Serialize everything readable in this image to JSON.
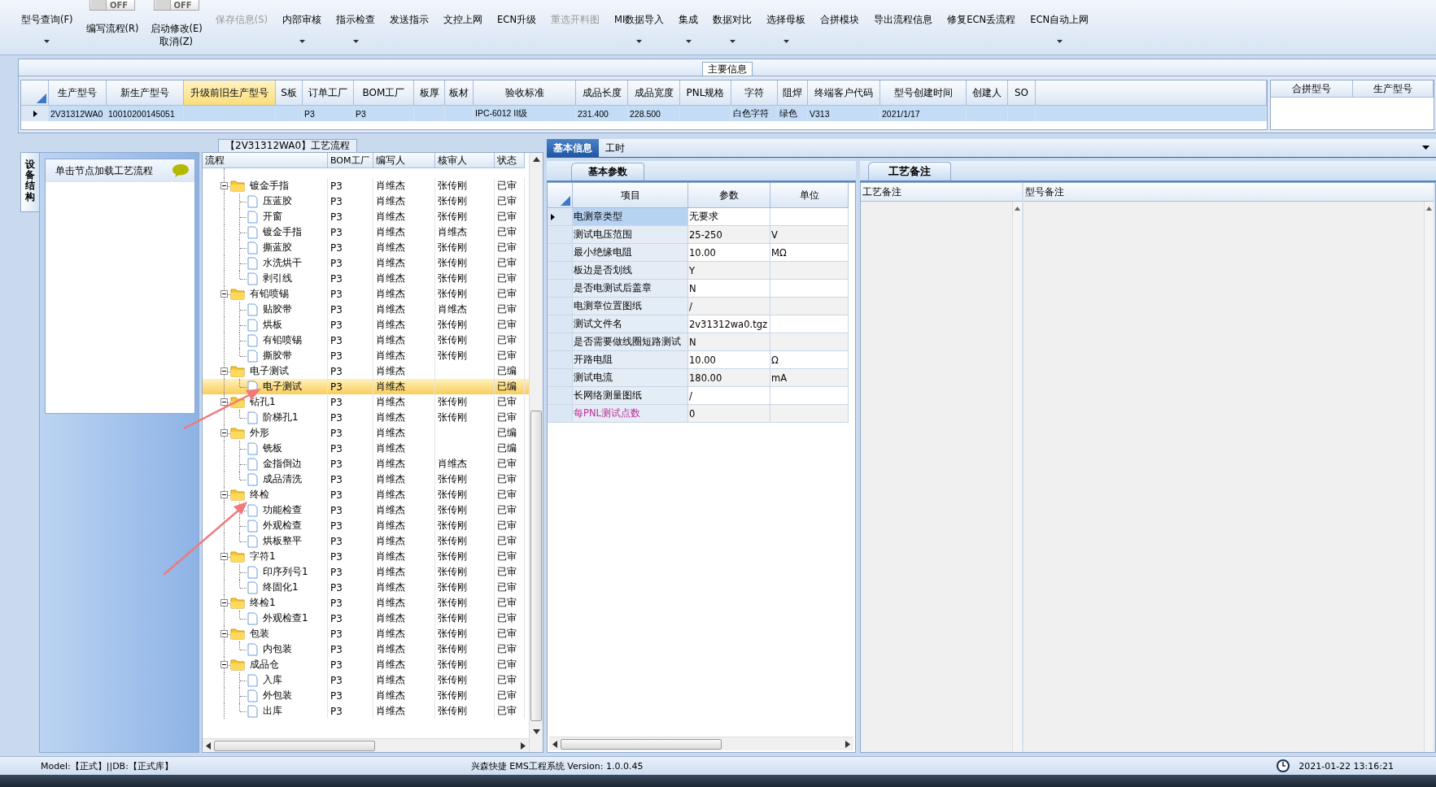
{
  "toolbar": {
    "items": [
      {
        "kind": "button",
        "label": "型号查询(F)",
        "dropdown": true,
        "disabled": false
      },
      {
        "kind": "toggle",
        "switch_text": "OFF",
        "on": false,
        "label": "编写流程(R)"
      },
      {
        "kind": "toggle",
        "switch_text": "OFF",
        "on": false,
        "label": "启动修改(E)",
        "second_label": "取消(Z)"
      },
      {
        "kind": "button",
        "label": "保存信息(S)",
        "dropdown": false,
        "disabled": true
      },
      {
        "kind": "button",
        "label": "内部审核",
        "dropdown": true,
        "disabled": false
      },
      {
        "kind": "button",
        "label": "指示检查",
        "dropdown": true,
        "disabled": false
      },
      {
        "kind": "button",
        "label": "发送指示",
        "dropdown": false,
        "disabled": false
      },
      {
        "kind": "button",
        "label": "文控上网",
        "dropdown": false,
        "disabled": false
      },
      {
        "kind": "button",
        "label": "ECN升级",
        "dropdown": false,
        "disabled": false
      },
      {
        "kind": "button",
        "label": "重选开料图",
        "dropdown": false,
        "disabled": true
      },
      {
        "kind": "button",
        "label": "MI数据导入",
        "dropdown": true,
        "disabled": false
      },
      {
        "kind": "button",
        "label": "集成",
        "dropdown": true,
        "disabled": false
      },
      {
        "kind": "button",
        "label": "数据对比",
        "dropdown": true,
        "disabled": false
      },
      {
        "kind": "button",
        "label": "选择母板",
        "dropdown": true,
        "disabled": false
      },
      {
        "kind": "button",
        "label": "合拼模块",
        "dropdown": false,
        "disabled": false
      },
      {
        "kind": "button",
        "label": "导出流程信息",
        "dropdown": false,
        "disabled": false
      },
      {
        "kind": "button",
        "label": "修复ECN丢流程",
        "dropdown": false,
        "disabled": false
      },
      {
        "kind": "button",
        "label": "ECN自动上网",
        "dropdown": true,
        "disabled": false
      }
    ]
  },
  "main_info": {
    "title": "主要信息",
    "columns": [
      {
        "label": "生产型号",
        "highlighted": false
      },
      {
        "label": "新生产型号",
        "highlighted": false
      },
      {
        "label": "升级前旧生产型号",
        "highlighted": true
      },
      {
        "label": "S板",
        "highlighted": false
      },
      {
        "label": "订单工厂",
        "highlighted": false
      },
      {
        "label": "BOM工厂",
        "highlighted": false
      },
      {
        "label": "板厚",
        "highlighted": false
      },
      {
        "label": "板材",
        "highlighted": false
      },
      {
        "label": "验收标准",
        "highlighted": false
      },
      {
        "label": "成品长度",
        "highlighted": false
      },
      {
        "label": "成品宽度",
        "highlighted": false
      },
      {
        "label": "PNL规格",
        "highlighted": false
      },
      {
        "label": "字符",
        "highlighted": false
      },
      {
        "label": "阻焊",
        "highlighted": false
      },
      {
        "label": "终端客户代码",
        "highlighted": false
      },
      {
        "label": "型号创建时间",
        "highlighted": false
      },
      {
        "label": "创建人",
        "highlighted": false
      },
      {
        "label": "SO",
        "highlighted": false
      }
    ],
    "rows": [
      {
        "selected": true,
        "cells": [
          "2V31312WA0",
          "10010200145051",
          null,
          null,
          "P3",
          "P3",
          null,
          null,
          "IPC-6012 II级",
          "231.400",
          "228.500",
          null,
          "白色字符",
          "绿色",
          "V313",
          "2021/1/17",
          null,
          null
        ]
      }
    ],
    "side_table": {
      "columns": [
        "合拼型号",
        "生产型号"
      ]
    }
  },
  "left_sidebar": {
    "tab": "设备结构",
    "hint": "单击节点加载工艺流程"
  },
  "process_tree": {
    "title": "【2V31312WA0】工艺流程",
    "columns": [
      "流程",
      "BOM工厂",
      "编写人",
      "核审人",
      "状态"
    ],
    "rows": [
      {
        "name": "镀金手指",
        "bom": "P3",
        "writer": "肖维杰",
        "reviewer": "张传刚",
        "status": "已审",
        "expanded": true,
        "selected": false,
        "children": [
          {
            "name": "压蓝胶",
            "bom": "P3",
            "writer": "肖维杰",
            "reviewer": "张传刚",
            "status": "已审",
            "selected": false
          },
          {
            "name": "开窗",
            "bom": "P3",
            "writer": "肖维杰",
            "reviewer": "张传刚",
            "status": "已审",
            "selected": false
          },
          {
            "name": "镀金手指",
            "bom": "P3",
            "writer": "肖维杰",
            "reviewer": "肖维杰",
            "status": "已审",
            "selected": false
          },
          {
            "name": "撕蓝胶",
            "bom": "P3",
            "writer": "肖维杰",
            "reviewer": "张传刚",
            "status": "已审",
            "selected": false
          },
          {
            "name": "水洗烘干",
            "bom": "P3",
            "writer": "肖维杰",
            "reviewer": "张传刚",
            "status": "已审",
            "selected": false
          },
          {
            "name": "剥引线",
            "bom": "P3",
            "writer": "肖维杰",
            "reviewer": "张传刚",
            "status": "已审",
            "selected": false
          }
        ]
      },
      {
        "name": "有铅喷锡",
        "bom": "P3",
        "writer": "肖维杰",
        "reviewer": "张传刚",
        "status": "已审",
        "expanded": true,
        "selected": false,
        "children": [
          {
            "name": "贴胶带",
            "bom": "P3",
            "writer": "肖维杰",
            "reviewer": "肖维杰",
            "status": "已审",
            "selected": false
          },
          {
            "name": "烘板",
            "bom": "P3",
            "writer": "肖维杰",
            "reviewer": "张传刚",
            "status": "已审",
            "selected": false
          },
          {
            "name": "有铅喷锡",
            "bom": "P3",
            "writer": "肖维杰",
            "reviewer": "张传刚",
            "status": "已审",
            "selected": false
          },
          {
            "name": "撕胶带",
            "bom": "P3",
            "writer": "肖维杰",
            "reviewer": "张传刚",
            "status": "已审",
            "selected": false
          }
        ]
      },
      {
        "name": "电子测试",
        "bom": "P3",
        "writer": "肖维杰",
        "status": "已编",
        "expanded": true,
        "selected": false,
        "children": [
          {
            "name": "电子测试",
            "bom": "P3",
            "writer": "肖维杰",
            "status": "已编",
            "selected": true
          }
        ]
      },
      {
        "name": "钻孔1",
        "bom": "P3",
        "writer": "肖维杰",
        "reviewer": "张传刚",
        "status": "已审",
        "expanded": true,
        "selected": false,
        "children": [
          {
            "name": "阶梯孔1",
            "bom": "P3",
            "writer": "肖维杰",
            "reviewer": "张传刚",
            "status": "已审",
            "selected": false
          }
        ]
      },
      {
        "name": "外形",
        "bom": "P3",
        "writer": "肖维杰",
        "status": "已编",
        "expanded": true,
        "selected": false,
        "children": [
          {
            "name": "铣板",
            "bom": "P3",
            "writer": "肖维杰",
            "status": "已编",
            "selected": false
          },
          {
            "name": "金指倒边",
            "bom": "P3",
            "writer": "肖维杰",
            "reviewer": "肖维杰",
            "status": "已审",
            "selected": false
          },
          {
            "name": "成品清洗",
            "bom": "P3",
            "writer": "肖维杰",
            "reviewer": "张传刚",
            "status": "已审",
            "selected": false
          }
        ]
      },
      {
        "name": "终检",
        "bom": "P3",
        "writer": "肖维杰",
        "reviewer": "张传刚",
        "status": "已审",
        "expanded": true,
        "selected": false,
        "children": [
          {
            "name": "功能检查",
            "bom": "P3",
            "writer": "肖维杰",
            "reviewer": "张传刚",
            "status": "已审",
            "selected": false
          },
          {
            "name": "外观检查",
            "bom": "P3",
            "writer": "肖维杰",
            "reviewer": "张传刚",
            "status": "已审",
            "selected": false
          },
          {
            "name": "烘板整平",
            "bom": "P3",
            "writer": "肖维杰",
            "reviewer": "张传刚",
            "status": "已审",
            "selected": false
          }
        ]
      },
      {
        "name": "字符1",
        "bom": "P3",
        "writer": "肖维杰",
        "reviewer": "张传刚",
        "status": "已审",
        "expanded": true,
        "selected": false,
        "children": [
          {
            "name": "印序列号1",
            "bom": "P3",
            "writer": "肖维杰",
            "reviewer": "张传刚",
            "status": "已审",
            "selected": false
          },
          {
            "name": "终固化1",
            "bom": "P3",
            "writer": "肖维杰",
            "reviewer": "张传刚",
            "status": "已审",
            "selected": false
          }
        ]
      },
      {
        "name": "终检1",
        "bom": "P3",
        "writer": "肖维杰",
        "reviewer": "张传刚",
        "status": "已审",
        "expanded": true,
        "selected": false,
        "children": [
          {
            "name": "外观检查1",
            "bom": "P3",
            "writer": "肖维杰",
            "reviewer": "张传刚",
            "status": "已审",
            "selected": false
          }
        ]
      },
      {
        "name": "包装",
        "bom": "P3",
        "writer": "肖维杰",
        "reviewer": "张传刚",
        "status": "已审",
        "expanded": true,
        "selected": false,
        "children": [
          {
            "name": "内包装",
            "bom": "P3",
            "writer": "肖维杰",
            "reviewer": "张传刚",
            "status": "已审",
            "selected": false
          }
        ]
      },
      {
        "name": "成品仓",
        "bom": "P3",
        "writer": "肖维杰",
        "reviewer": "张传刚",
        "status": "已审",
        "expanded": true,
        "selected": false,
        "children": [
          {
            "name": "入库",
            "bom": "P3",
            "writer": "肖维杰",
            "reviewer": "张传刚",
            "status": "已审",
            "selected": false
          },
          {
            "name": "外包装",
            "bom": "P3",
            "writer": "肖维杰",
            "reviewer": "张传刚",
            "status": "已审",
            "selected": false
          },
          {
            "name": "出库",
            "bom": "P3",
            "writer": "肖维杰",
            "reviewer": "张传刚",
            "status": "已审",
            "selected": false
          }
        ]
      }
    ]
  },
  "details": {
    "tabs": [
      {
        "label": "基本信息",
        "selected": true
      },
      {
        "label": "工时",
        "selected": false
      }
    ],
    "params": {
      "tab": "基本参数",
      "columns": [
        "项目",
        "参数",
        "单位"
      ],
      "rows": [
        {
          "item": "电测章类型",
          "value": "无要求",
          "selected": true,
          "flagged": false
        },
        {
          "item": "测试电压范围",
          "value": "25-250",
          "unit": "V",
          "selected": false,
          "flagged": false
        },
        {
          "item": "最小绝缘电阻",
          "value": "10.00",
          "unit": "MΩ",
          "selected": false,
          "flagged": false
        },
        {
          "item": "板边是否划线",
          "value": "Y",
          "selected": false,
          "flagged": false
        },
        {
          "item": "是否电测试后盖章",
          "value": "N",
          "selected": false,
          "flagged": false
        },
        {
          "item": "电测章位置图纸",
          "value": "/",
          "selected": false,
          "flagged": false
        },
        {
          "item": "测试文件名",
          "value": "2v31312wa0.tgz",
          "selected": false,
          "flagged": false
        },
        {
          "item": "是否需要做线圈短路测试",
          "value": "N",
          "selected": false,
          "flagged": false
        },
        {
          "item": "开路电阻",
          "value": "10.00",
          "unit": "Ω",
          "selected": false,
          "flagged": false
        },
        {
          "item": "测试电流",
          "value": "180.00",
          "unit": "mA",
          "selected": false,
          "flagged": false
        },
        {
          "item": "长网络测量图纸",
          "value": "/",
          "selected": false,
          "flagged": false
        },
        {
          "item": "每PNL测试点数",
          "value": "0",
          "selected": false,
          "flagged": true
        }
      ]
    },
    "remarks": {
      "tab": "工艺备注",
      "columns": [
        "工艺备注",
        "型号备注"
      ]
    }
  },
  "status_bar": {
    "left": "Model:【正式】||DB:【正式库】",
    "center": "兴森快捷 EMS工程系统 Version: 1.0.0.45",
    "datetime": "2021-01-22 13:16:21"
  }
}
